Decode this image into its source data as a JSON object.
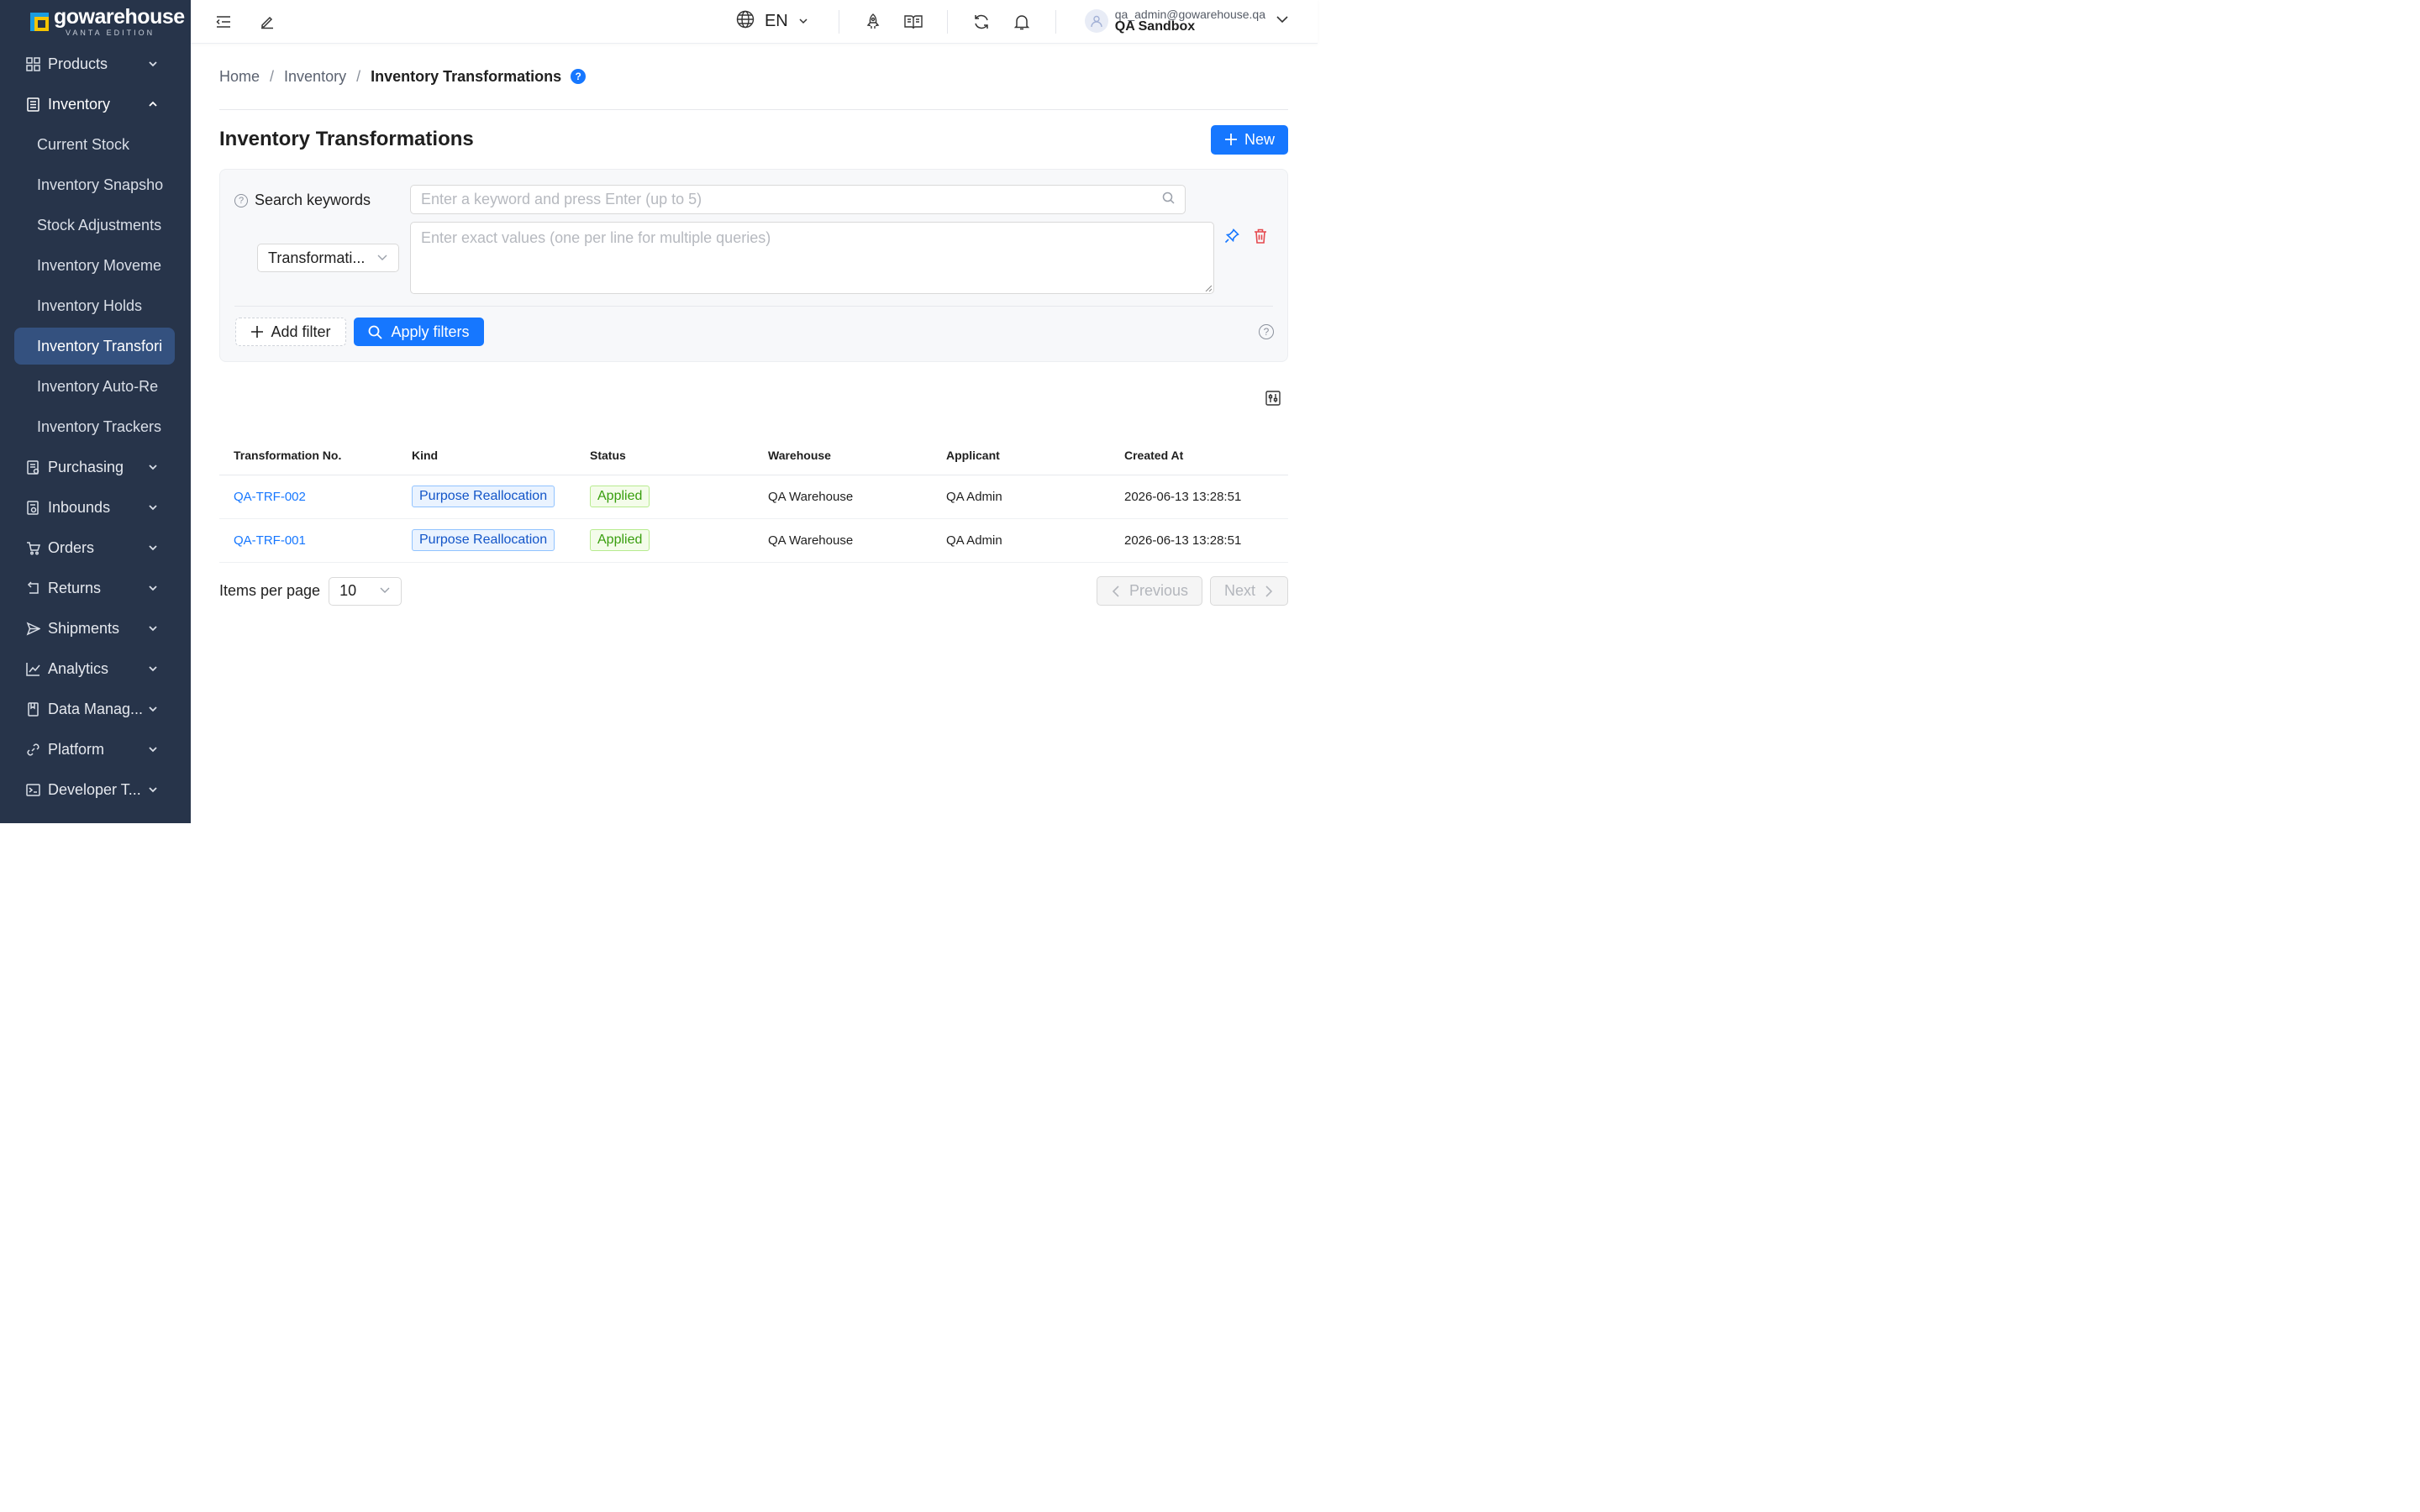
{
  "app": {
    "logo_name": "gowarehouse",
    "logo_sub": "VANTA EDITION",
    "brand_colors": {
      "sidebar": "#27344a",
      "primary": "#1677ff",
      "logo_blue": "#1a9de0",
      "logo_yellow": "#f5c400"
    }
  },
  "sidebar": {
    "items": [
      {
        "label": "Products",
        "icon": "grid-icon"
      },
      {
        "label": "Inventory",
        "icon": "inventory-icon",
        "open": true
      },
      {
        "label": "Purchasing",
        "icon": "purchasing-icon"
      },
      {
        "label": "Inbounds",
        "icon": "inbounds-icon"
      },
      {
        "label": "Orders",
        "icon": "cart-icon"
      },
      {
        "label": "Returns",
        "icon": "returns-icon"
      },
      {
        "label": "Shipments",
        "icon": "send-icon"
      },
      {
        "label": "Analytics",
        "icon": "chart-icon"
      },
      {
        "label": "Data Manag...",
        "icon": "book-icon"
      },
      {
        "label": "Platform",
        "icon": "link-icon"
      },
      {
        "label": "Developer T...",
        "icon": "terminal-icon"
      }
    ],
    "inventory_sub": [
      {
        "label": "Current Stock"
      },
      {
        "label": "Inventory Snapsho"
      },
      {
        "label": "Stock Adjustments"
      },
      {
        "label": "Inventory Moveme"
      },
      {
        "label": "Inventory Holds"
      },
      {
        "label": "Inventory Transfori",
        "active": true
      },
      {
        "label": "Inventory Auto-Re"
      },
      {
        "label": "Inventory Trackers"
      }
    ]
  },
  "topbar": {
    "language": "EN",
    "user_email": "qa_admin@gowarehouse.qa",
    "user_org": "QA Sandbox"
  },
  "breadcrumb": {
    "home": "Home",
    "section": "Inventory",
    "current": "Inventory Transformations",
    "help": "?"
  },
  "page": {
    "title": "Inventory Transformations",
    "new_label": "New"
  },
  "filters": {
    "search_label": "Search keywords",
    "search_placeholder": "Enter a keyword and press Enter (up to 5)",
    "field_select": "Transformati...",
    "values_placeholder": "Enter exact values (one per line for multiple queries)",
    "add_filter_label": "Add filter",
    "apply_label": "Apply filters"
  },
  "table": {
    "columns": [
      "Transformation No.",
      "Kind",
      "Status",
      "Warehouse",
      "Applicant",
      "Created At"
    ],
    "rows": [
      {
        "no": "QA-TRF-002",
        "kind": "Purpose Reallocation",
        "status": "Applied",
        "warehouse": "QA Warehouse",
        "applicant": "QA Admin",
        "created": "2026-06-13 13:28:51"
      },
      {
        "no": "QA-TRF-001",
        "kind": "Purpose Reallocation",
        "status": "Applied",
        "warehouse": "QA Warehouse",
        "applicant": "QA Admin",
        "created": "2026-06-13 13:28:51"
      }
    ]
  },
  "pagination": {
    "items_per_page_label": "Items per page",
    "items_per_page": "10",
    "previous_label": "Previous",
    "next_label": "Next"
  }
}
